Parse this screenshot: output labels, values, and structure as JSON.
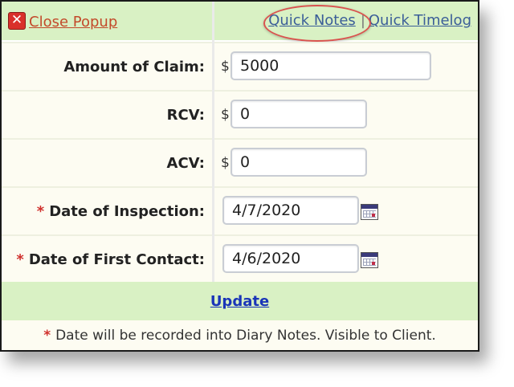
{
  "header": {
    "close_label": "Close Popup",
    "quick_notes_label": "Quick Notes",
    "separator": "|",
    "quick_timelog_label": "Quick Timelog"
  },
  "form": {
    "amount_of_claim": {
      "label": "Amount of Claim:",
      "currency": "$",
      "value": "5000"
    },
    "rcv": {
      "label": "RCV:",
      "currency": "$",
      "value": "0"
    },
    "acv": {
      "label": "ACV:",
      "currency": "$",
      "value": "0"
    },
    "date_of_inspection": {
      "required_mark": "*",
      "label": "Date of Inspection:",
      "value": "4/7/2020"
    },
    "date_of_first_contact": {
      "required_mark": "*",
      "label": "Date of First Contact:",
      "value": "4/6/2020"
    }
  },
  "update_label": "Update",
  "footer_note": {
    "required_mark": "*",
    "text": "Date will be recorded into Diary Notes. Visible to Client."
  },
  "colors": {
    "header_bg": "#d9f1c4",
    "close_link": "#c34a2a",
    "link": "#3b5e98",
    "update_link": "#1a35b8",
    "required": "#d0312d",
    "highlight_ring": "#d9534f"
  },
  "icons": [
    "close-icon",
    "calendar-icon"
  ]
}
